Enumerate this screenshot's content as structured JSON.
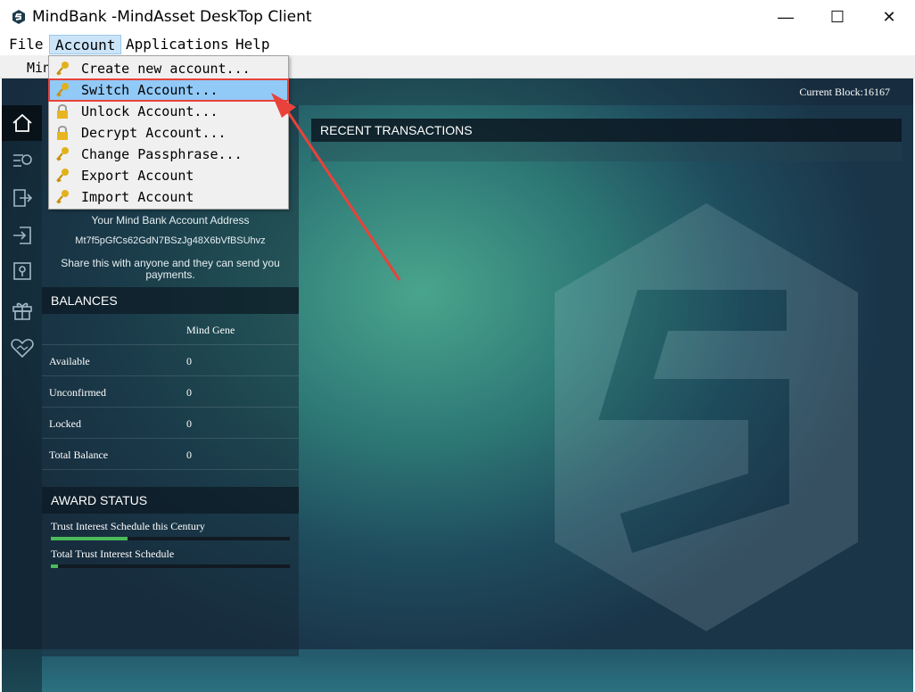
{
  "window": {
    "title": "MindBank -MindAsset DeskTop Client",
    "minimize": "—",
    "maximize": "☐",
    "close": "✕"
  },
  "menubar": {
    "file": "File",
    "account": "Account",
    "applications": "Applications",
    "help": "Help"
  },
  "toolbar": {
    "text": "Min"
  },
  "status": {
    "current_block": "Current Block:16167"
  },
  "sidebar": {
    "icons": [
      "home-icon",
      "transfer-history-icon",
      "send-icon",
      "receive-icon",
      "location-icon",
      "gift-icon",
      "handshake-heart-icon"
    ]
  },
  "account_menu": {
    "items": [
      {
        "label": "Create new account...",
        "icon": "key-icon"
      },
      {
        "label": "Switch Account...",
        "icon": "key-icon"
      },
      {
        "label": "Unlock Account...",
        "icon": "lock-icon"
      },
      {
        "label": "Decrypt Account...",
        "icon": "lock-icon"
      },
      {
        "label": "Change Passphrase...",
        "icon": "key-icon"
      },
      {
        "label": "Export Account",
        "icon": "key-icon"
      },
      {
        "label": "Import Account",
        "icon": "key-icon"
      }
    ],
    "highlighted_index": 1
  },
  "address": {
    "label": "Your Mind Bank Account Address",
    "value": "Mt7f5pGfCs62GdN7BSzJg48X6bVfBSUhvz",
    "hint_line1": "Share this with anyone and they can send you",
    "hint_line2": "payments."
  },
  "balances": {
    "title": "BALANCES",
    "column": "Mind Gene",
    "rows": [
      {
        "label": "Available",
        "value": "0"
      },
      {
        "label": "Unconfirmed",
        "value": "0"
      },
      {
        "label": "Locked",
        "value": "0"
      },
      {
        "label": "Total Balance",
        "value": "0"
      }
    ]
  },
  "award": {
    "title": "AWARD STATUS",
    "items": [
      {
        "label": "Trust Interest Schedule this Century",
        "progress": 0.32
      },
      {
        "label": "Total Trust Interest Schedule",
        "progress": 0.03
      }
    ]
  },
  "recent": {
    "title": "RECENT TRANSACTIONS"
  },
  "colors": {
    "accent_green": "#4cbb5a",
    "menu_highlight": "#91c9f7",
    "annotation_red": "#e8423b"
  }
}
